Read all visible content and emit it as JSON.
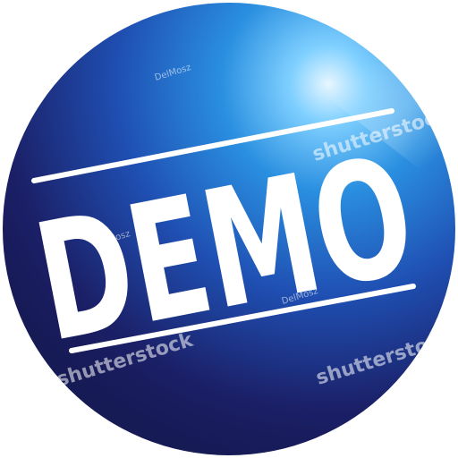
{
  "badge": {
    "text": "DEMO",
    "text_color": "#ffffff",
    "rule_color": "#ffffff",
    "colors": {
      "deep_navy": "#1b1f66",
      "mid_blue": "#1f4fb2",
      "bright_blue": "#2a8fe0",
      "highlight": "#bfe6ff"
    }
  },
  "watermarks": {
    "brand": "shutterstock",
    "author": "DelMosz"
  }
}
